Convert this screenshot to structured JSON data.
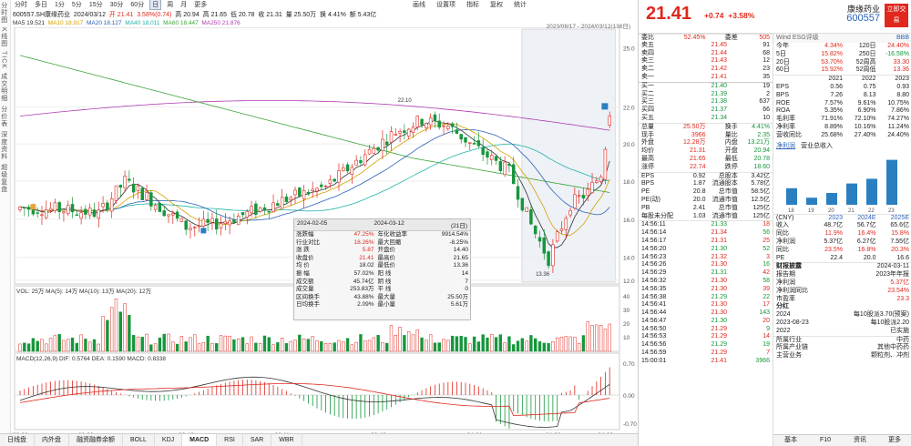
{
  "leftbar": [
    "分时图",
    "K线图",
    "TICK",
    "成交明细",
    "分价表",
    "深度资料",
    "超级复盘"
  ],
  "toolbar": {
    "items": [
      "分时",
      "多日",
      "1分",
      "5分",
      "15分",
      "30分",
      "60分",
      "日",
      "周",
      "月",
      "更多"
    ],
    "active": "日",
    "right": [
      "画线",
      "设置项",
      "指标",
      "复权",
      "统计"
    ]
  },
  "stock_line": {
    "code_name": "600557.SH康缘药业",
    "date": "2024/03/12",
    "open": "开 21.41",
    "change": "3.58%(0.74)",
    "high": "高 20.94",
    "low": "高 21.65",
    "close": "低 20.78",
    "vol": "收 21.31",
    "amt": "量 25.50万",
    "turnover": "换 4.41%",
    "amount": "额 5.43亿"
  },
  "ma_line": {
    "ma5": "MA5 19.521",
    "ma10": "MA10 18.917",
    "ma20": "MA20 18.127",
    "ma40": "MA40 18.011",
    "ma60": "MA60 18.447",
    "ma250": "MA250 21.876"
  },
  "date_range": "2023/08/17 - 2024/03/12(136日)",
  "price_axis": [
    "22.0",
    "20.0",
    "18.0",
    "16.0",
    "14.0",
    "12.0"
  ],
  "top_axis": "25.0",
  "annot": {
    "high": "22.10",
    "low": "13.36"
  },
  "vol_label": "VOL: 25万 MA(5): 14万 MA(10): 13万 MA(20): 12万",
  "vol_axis": [
    "40",
    "30",
    "20",
    "10"
  ],
  "macd_label": "MACD(12,26,9) DIF: 0.5764 DEA: 0.1590 MACD: 0.8338",
  "macd_axis": [
    "0.70",
    "0.00",
    "-0.70"
  ],
  "x_dates": [
    "23-08",
    "23-09",
    "23-10",
    "23-11",
    "23-12",
    "24-01",
    "24-02",
    "24-03"
  ],
  "ohlc_box": {
    "hd_left": "2024-02-05",
    "hd_mid": "2024-03-12",
    "hd_right": "(21日)",
    "rows": [
      [
        "涨跌幅",
        "47.25%",
        "年化收益率",
        "9914.54%"
      ],
      [
        "行业对比",
        "18.26%",
        "最大回撤",
        "-8.25%"
      ],
      [
        "涨 跌",
        "5.87",
        "开盘价",
        "14.40"
      ],
      [
        "收盘价",
        "21.41",
        "最高价",
        "21.65"
      ],
      [
        "均 价",
        "18.02",
        "最低价",
        "13.36"
      ],
      [
        "振 幅",
        "57.02%",
        "阳 线",
        "14"
      ],
      [
        "成交额",
        "45.74亿",
        "阴 线",
        "7"
      ],
      [
        "成交量",
        "253.83万",
        "平 线",
        "0"
      ],
      [
        "区间换手",
        "43.88%",
        "最大量",
        "25.50万"
      ],
      [
        "日均换手",
        "2.09%",
        "最小量",
        "5.61万"
      ]
    ]
  },
  "bottom_tabs": [
    "日线盘",
    "内外盘",
    "融资融券余额",
    "BOLL",
    "KDJ",
    "MACD",
    "RSI",
    "SAR",
    "WBR"
  ],
  "bottom_active": "MACD",
  "quote": {
    "price": "21.41",
    "change": "+0.74",
    "pct": "+3.58%",
    "name": "康缘药业",
    "code": "600557",
    "trade": "立即交易"
  },
  "ratio": {
    "wb_label": "委比",
    "wb": "52.45%",
    "wc_label": "委差",
    "wc": "505"
  },
  "asks": [
    [
      "卖五",
      "21.45",
      "91"
    ],
    [
      "卖四",
      "21.44",
      "68"
    ],
    [
      "卖三",
      "21.43",
      "12"
    ],
    [
      "卖二",
      "21.42",
      "23"
    ],
    [
      "卖一",
      "21.41",
      "35"
    ]
  ],
  "bids": [
    [
      "买一",
      "21.40",
      "19"
    ],
    [
      "买二",
      "21.39",
      "2"
    ],
    [
      "买三",
      "21.38",
      "637"
    ],
    [
      "买四",
      "21.37",
      "66"
    ],
    [
      "买五",
      "21.34",
      "10"
    ]
  ],
  "stats": [
    [
      "总量",
      "25.50万",
      "换手",
      "4.41%"
    ],
    [
      "现手",
      "3966",
      "量比",
      "2.35"
    ],
    [
      "外盘",
      "12.28万",
      "内盘",
      "13.21万"
    ],
    [
      "均价",
      "21.31",
      "开盘",
      "20.94"
    ],
    [
      "最高",
      "21.65",
      "最低",
      "20.78"
    ],
    [
      "涨停",
      "22.74",
      "跌停",
      "18.60"
    ]
  ],
  "fin1": [
    [
      "EPS",
      "0.92",
      "总股本",
      "3.42亿"
    ],
    [
      "BPS",
      "1.87",
      "流通股本",
      "5.78亿"
    ],
    [
      "PE",
      "20.8",
      "总市值",
      "58.5亿"
    ],
    [
      "PE(动)",
      "20.0",
      "流通市值",
      "12.5亿"
    ],
    [
      "PB",
      "2.41",
      "总市值",
      "125亿"
    ],
    [
      "每股未分配",
      "1.03",
      "流通市值",
      "125亿"
    ]
  ],
  "ticks": [
    [
      "14:56:11",
      "21.33",
      "18"
    ],
    [
      "14:56:14",
      "21.34",
      "56"
    ],
    [
      "14:56:17",
      "21.31",
      "25"
    ],
    [
      "14:56:20",
      "21.30",
      "52"
    ],
    [
      "14:56:23",
      "21.32",
      "3"
    ],
    [
      "14:56:26",
      "21.30",
      "16"
    ],
    [
      "14:56:29",
      "21.31",
      "42"
    ],
    [
      "14:56:32",
      "21.30",
      "58"
    ],
    [
      "14:56:35",
      "21.30",
      "39"
    ],
    [
      "14:56:38",
      "21.29",
      "22"
    ],
    [
      "14:56:41",
      "21.30",
      "17"
    ],
    [
      "14:56:44",
      "21.30",
      "143"
    ],
    [
      "14:56:47",
      "21.30",
      "20"
    ],
    [
      "14:56:50",
      "21.29",
      "9"
    ],
    [
      "14:56:53",
      "21.29",
      "14"
    ],
    [
      "14:56:56",
      "21.29",
      "19"
    ],
    [
      "14:56:59",
      "21.29",
      "7"
    ],
    [
      "15:00:01",
      "21.41",
      "3966"
    ]
  ],
  "rating": {
    "label": "Wind ESG评级",
    "value": "BBB"
  },
  "perf_hd": [
    "",
    "近1月",
    "近3月",
    "1年",
    "3年",
    "近52周"
  ],
  "perf": [
    [
      "今年",
      "4.34%",
      "120日",
      "24.40%"
    ],
    [
      "5日",
      "15.82%",
      "250日",
      "-16.58%"
    ],
    [
      "20日",
      "53.70%",
      "52周高",
      "33.30"
    ],
    [
      "60日",
      "15.92%",
      "52周低",
      "13.36"
    ]
  ],
  "fin_hd": [
    "",
    "2021",
    "2022",
    "2023"
  ],
  "fin": [
    [
      "EPS",
      "0.56",
      "0.75",
      "0.93"
    ],
    [
      "BPS",
      "7.26",
      "8.13",
      "8.80"
    ],
    [
      "ROE",
      "7.57%",
      "9.61%",
      "10.75%"
    ],
    [
      "ROA",
      "5.35%",
      "6.90%",
      "7.86%"
    ],
    [
      "毛利率",
      "71.91%",
      "72.10%",
      "74.27%"
    ],
    [
      "净利率",
      "8.89%",
      "10.16%",
      "11.24%"
    ],
    [
      "营收同比",
      "25.68%",
      "27.40%",
      "24.40%"
    ]
  ],
  "chart_tabs": [
    "净利润",
    "营业总收入"
  ],
  "bar_years": [
    "18",
    "19",
    "20",
    "21",
    "22",
    "23"
  ],
  "bar_values": [
    0.35,
    0.15,
    0.25,
    0.45,
    0.55,
    0.95
  ],
  "fc_hd": [
    "(CNY)",
    "2023",
    "2024E",
    "2025E"
  ],
  "fc": [
    [
      "收入",
      "48.7亿",
      "56.7亿",
      "65.6亿"
    ],
    [
      "同比",
      "11.9%",
      "16.4%",
      "15.8%"
    ],
    [
      "净利润",
      "5.37亿",
      "6.27亿",
      "7.55亿"
    ],
    [
      "同比",
      "23.5%",
      "16.8%",
      "20.3%"
    ],
    [
      "PE",
      "22.4",
      "20.0",
      "16.6"
    ]
  ],
  "report": {
    "title": "财报披露",
    "date": "2024-03-11",
    "rows": [
      [
        "报告期",
        "2023年年报"
      ],
      [
        "净利润",
        "5.37亿"
      ],
      [
        "净利润同比",
        "23.54%"
      ],
      [
        "市盈率",
        "23.3"
      ]
    ]
  },
  "dividend": {
    "title": "分红",
    "rows": [
      [
        "2024",
        "每10股派3.70(预案)"
      ],
      [
        "2023-08-23",
        "每10股派2.20"
      ],
      [
        "2022",
        "已实施"
      ]
    ]
  },
  "industry": [
    [
      "所属行业",
      "中药"
    ],
    [
      "所属产业链",
      "其他中药药"
    ],
    [
      "主营业务",
      "颗粒剂、冲剂"
    ]
  ],
  "rbottom": [
    "基本",
    "F10",
    "资讯",
    "更多"
  ],
  "colors": {
    "up": "#e0281e",
    "down": "#16963c",
    "accent": "#2a62b8"
  }
}
